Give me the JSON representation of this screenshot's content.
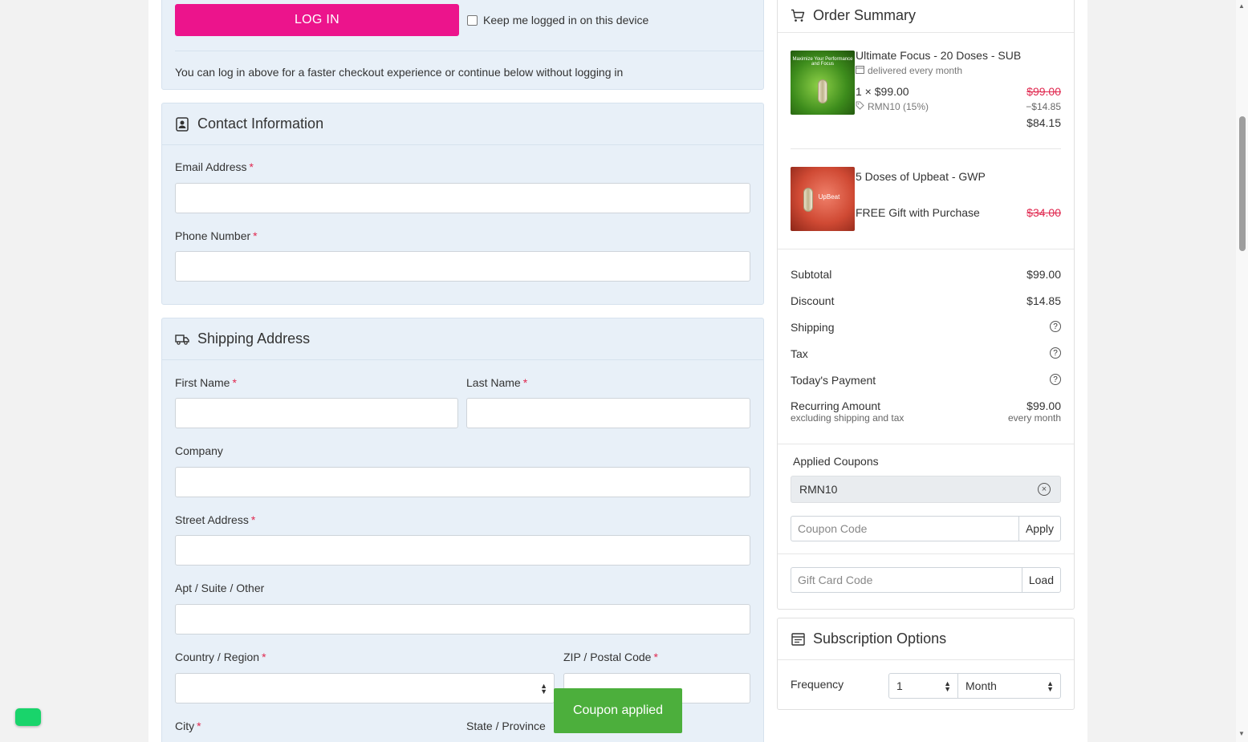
{
  "login": {
    "button_label": "LOG IN",
    "keep_logged_label": "Keep me logged in on this device",
    "note": "You can log in above for a faster checkout experience or continue below without logging in"
  },
  "contact": {
    "title": "Contact Information",
    "email_label": "Email Address",
    "phone_label": "Phone Number"
  },
  "shipping": {
    "title": "Shipping Address",
    "first_name_label": "First Name",
    "last_name_label": "Last Name",
    "company_label": "Company",
    "street_label": "Street Address",
    "apt_label": "Apt / Suite / Other",
    "country_label": "Country / Region",
    "zip_label": "ZIP / Postal Code",
    "city_label": "City",
    "state_label": "State / Province"
  },
  "required_mark": "*",
  "summary": {
    "title": "Order Summary",
    "items": [
      {
        "name": "Ultimate Focus - 20 Doses - SUB",
        "delivery": "delivered every month",
        "qty_price": "1 × $99.00",
        "original": "$99.00",
        "discount": "−$14.85",
        "coupon_note": "RMN10 (15%)",
        "final": "$84.15",
        "thumb_text": "Maximize Your Performance and Focus"
      },
      {
        "name": "5 Doses of Upbeat - GWP",
        "note": "FREE Gift with Purchase",
        "original": "$34.00",
        "thumb_text": "UpBeat"
      }
    ],
    "totals": {
      "subtotal_label": "Subtotal",
      "subtotal": "$99.00",
      "discount_label": "Discount",
      "discount": "$14.85",
      "shipping_label": "Shipping",
      "tax_label": "Tax",
      "today_label": "Today's Payment",
      "recurring_label": "Recurring Amount",
      "recurring_sub": "excluding shipping and tax",
      "recurring": "$99.00",
      "recurring_period": "every month",
      "help_glyph": "?"
    },
    "coupons": {
      "title": "Applied Coupons",
      "applied": "RMN10",
      "remove_glyph": "×",
      "placeholder": "Coupon Code",
      "apply_label": "Apply"
    },
    "giftcard": {
      "placeholder": "Gift Card Code",
      "load_label": "Load"
    }
  },
  "subscription": {
    "title": "Subscription Options",
    "frequency_label": "Frequency",
    "frequency_value": "1",
    "period_value": "Month"
  },
  "toast": "Coupon applied",
  "colors": {
    "login_button": "#ec148c",
    "panel_bg": "#e8f0f8",
    "required": "#e0284f",
    "toast": "#4caf3c",
    "chat_button": "#19d46b"
  }
}
